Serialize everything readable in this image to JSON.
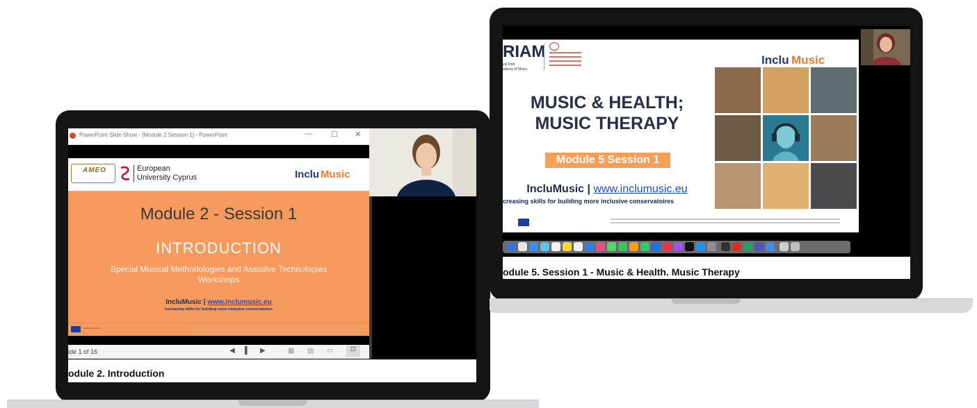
{
  "left": {
    "window_title": "PowerPoint Slide Show - [Module 2 Session 1] - PowerPoint",
    "window_controls": {
      "minimize": "—",
      "maximize": "☐",
      "close": "✕"
    },
    "slide": {
      "logo_text": "AMEO",
      "partner": "European University Cyprus",
      "partner_line1": "European",
      "partner_line2": "University Cyprus",
      "brand_left": "Inclu",
      "brand_right": "Music",
      "title": "Module 2 - Session 1",
      "heading": "INTRODUCTION",
      "subtitle": "Special Musical Methodologies and Assistive Technologies Workshops",
      "project_name": "IncluMusic |",
      "project_url": "www.inclumusic.eu",
      "tagline": "Increasing skills for building more inclusive conservatoires"
    },
    "status": {
      "slide_counter": "ide 1 of 16"
    },
    "caption": "odule 2. Introduction"
  },
  "right": {
    "slide": {
      "logo_riam": "RIAM",
      "riam_sub1": "yal Irish",
      "riam_sub2": "ademy of Music",
      "brand_left": "Inclu",
      "brand_right": "Music",
      "title_line1": "MUSIC & HEALTH;",
      "title_line2": "MUSIC THERAPY",
      "session_badge": "Module 5 Session 1",
      "project_name": "IncluMusic |",
      "project_url": "www.inclumusic.eu",
      "tagline": "creasing skills for building more inclusive conservatoires"
    },
    "caption": "odule 5. Session 1 - Music & Health. Music Therapy"
  },
  "colors": {
    "slide_orange": "#f79a5d",
    "brand_blue": "#1f3a7a",
    "brand_orange": "#f07c2a",
    "link_blue": "#1a4fd6",
    "badge_orange": "#f6a057"
  }
}
